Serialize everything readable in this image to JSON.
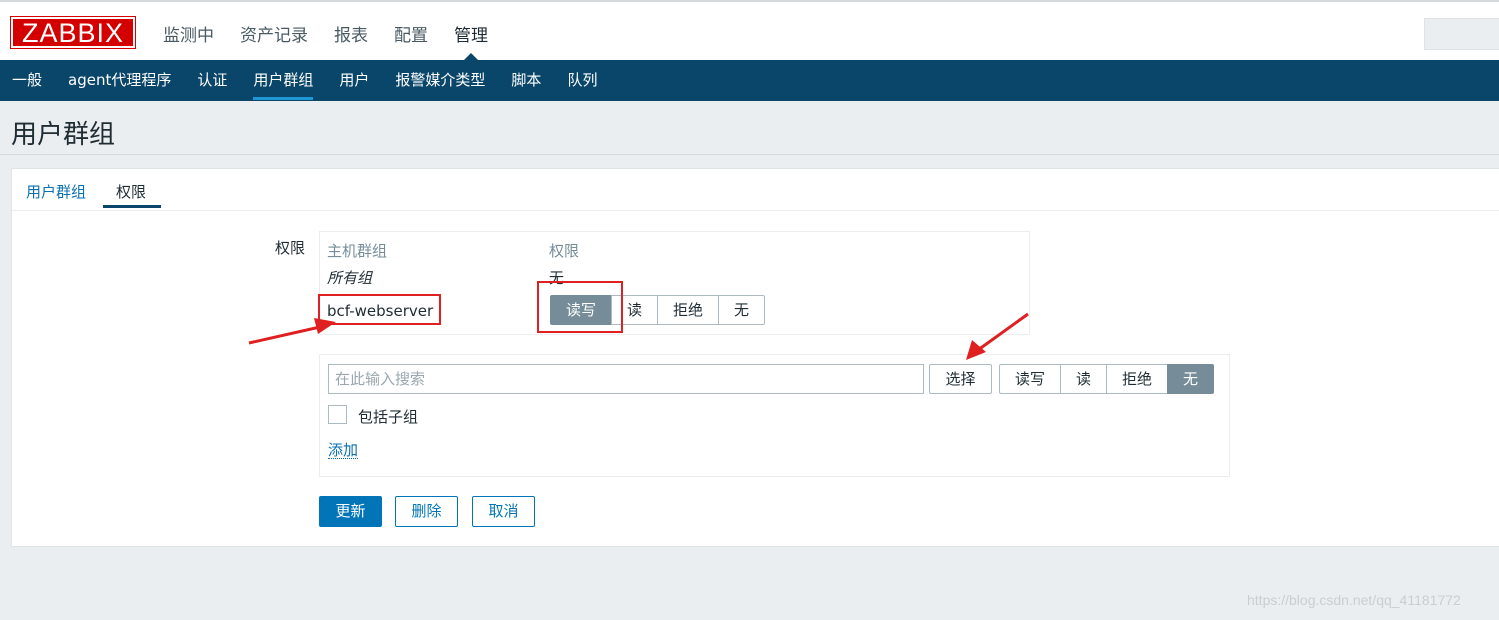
{
  "logo": {
    "text": "ZABBIX"
  },
  "main_nav": {
    "items": [
      "监测中",
      "资产记录",
      "报表",
      "配置",
      "管理"
    ]
  },
  "sub_nav": {
    "items": [
      "一般",
      "agent代理程序",
      "认证",
      "用户群组",
      "用户",
      "报警媒介类型",
      "脚本",
      "队列"
    ]
  },
  "page": {
    "title": "用户群组"
  },
  "tabs": {
    "user_groups": "用户群组",
    "permissions": "权限"
  },
  "permissions": {
    "label": "权限",
    "header_host_group": "主机群组",
    "header_permission": "权限",
    "all_groups": {
      "name": "所有组",
      "permission": "无"
    },
    "row": {
      "name": "bcf-webserver"
    },
    "options": {
      "read_write": "读写",
      "read": "读",
      "deny": "拒绝",
      "none": "无"
    }
  },
  "add_form": {
    "search_placeholder": "在此输入搜索",
    "select_button": "选择",
    "include_subgroups": "包括子组",
    "add_link": "添加"
  },
  "buttons": {
    "update": "更新",
    "delete": "删除",
    "cancel": "取消"
  },
  "watermark": "https://blog.csdn.net/qq_41181772",
  "colors": {
    "navy": "#0a466a",
    "annotation_red": "#e02020",
    "primary_blue": "#0275b8"
  }
}
